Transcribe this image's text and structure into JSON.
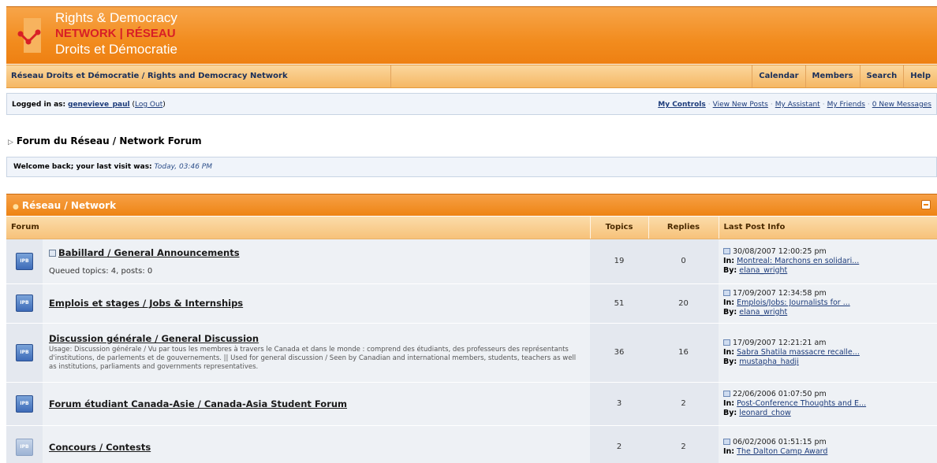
{
  "header": {
    "logo_line1": "Rights & Democracy",
    "logo_line2": "NETWORK | RÉSEAU",
    "logo_line3": "Droits et Démocratie"
  },
  "nav": {
    "site_link": "Réseau Droits et Démocratie / Rights and Democracy Network",
    "calendar": "Calendar",
    "members": "Members",
    "search": "Search",
    "help": "Help"
  },
  "userbar": {
    "logged_in_label": "Logged in as:",
    "username": "genevieve_paul",
    "logout": "Log Out",
    "my_controls": "My Controls",
    "view_new_posts": "View New Posts",
    "my_assistant": "My Assistant",
    "my_friends": "My Friends",
    "new_messages": "0 New Messages"
  },
  "breadcrumb": "Forum du Réseau / Network Forum",
  "welcome": {
    "label": "Welcome back; your last visit was:",
    "value": "Today, 03:46 PM"
  },
  "category": {
    "title": "Réseau / Network"
  },
  "table": {
    "headers": {
      "forum": "Forum",
      "topics": "Topics",
      "replies": "Replies",
      "last_post": "Last Post Info"
    },
    "rows": [
      {
        "title": "Babillard / General Announcements",
        "desc": "",
        "queued": "Queued topics: 4, posts: 0",
        "topics": "19",
        "replies": "0",
        "last_date": "30/08/2007 12:00:25 pm",
        "last_in": "Montreal: Marchons en solidari...",
        "last_by": "elana_wright"
      },
      {
        "title": "Emplois et stages / Jobs & Internships",
        "desc": "",
        "queued": "",
        "topics": "51",
        "replies": "20",
        "last_date": "17/09/2007 12:34:58 pm",
        "last_in": "Emplois/Jobs: Journalists for ...",
        "last_by": "elana_wright"
      },
      {
        "title": "Discussion générale / General Discussion",
        "desc": "Usage: Discussion générale / Vu par tous les membres à travers le Canada et dans le monde : comprend des étudiants, des professeurs des représentants d'institutions, de parlements et de gouvernements. || Used for general discussion / Seen by Canadian and international members, students, teachers as well as institutions, parliaments and governments representatives.",
        "queued": "",
        "topics": "36",
        "replies": "16",
        "last_date": "17/09/2007 12:21:21 am",
        "last_in": "Sabra Shatila massacre recalle...",
        "last_by": "mustapha_hadji"
      },
      {
        "title": "Forum étudiant Canada-Asie / Canada-Asia Student Forum",
        "desc": "",
        "queued": "",
        "topics": "3",
        "replies": "2",
        "last_date": "22/06/2006 01:07:50 pm",
        "last_in": "Post-Conference Thoughts and E...",
        "last_by": "leonard_chow"
      },
      {
        "title": "Concours / Contests",
        "desc": "",
        "queued": "",
        "topics": "2",
        "replies": "2",
        "last_date": "06/02/2006 01:51:15 pm",
        "last_in": "The Dalton Camp Award",
        "last_by": ""
      }
    ],
    "in_label": "In:",
    "by_label": "By:",
    "ipb_label": "IPB"
  }
}
